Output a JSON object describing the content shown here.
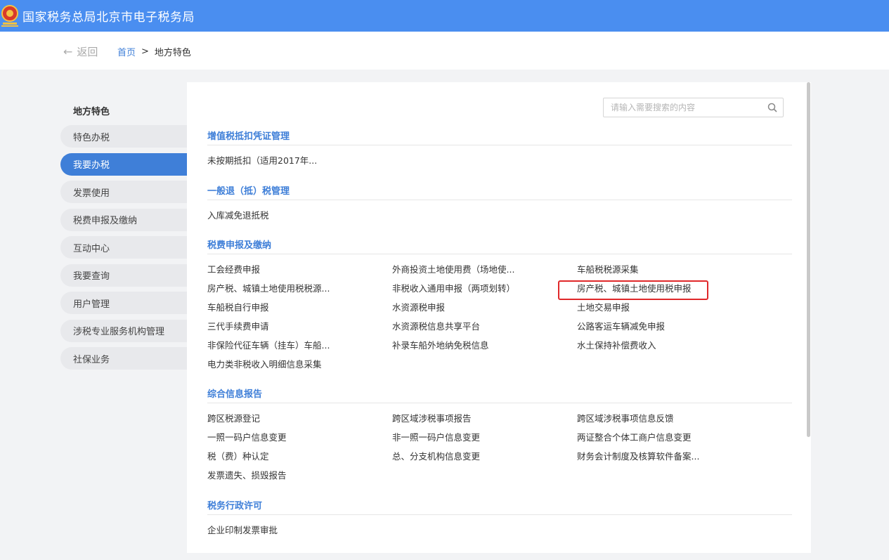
{
  "header": {
    "title": "国家税务总局北京市电子税务局"
  },
  "nav": {
    "back": "返回",
    "home": "首页",
    "sep": ">",
    "current": "地方特色"
  },
  "sidebar": {
    "title": "地方特色",
    "items": [
      {
        "label": "特色办税"
      },
      {
        "label": "我要办税"
      },
      {
        "label": "发票使用"
      },
      {
        "label": "税费申报及缴纳"
      },
      {
        "label": "互动中心"
      },
      {
        "label": "我要查询"
      },
      {
        "label": "用户管理"
      },
      {
        "label": "涉税专业服务机构管理"
      },
      {
        "label": "社保业务"
      }
    ],
    "active_index": 1
  },
  "search": {
    "placeholder": "请输入需要搜索的内容"
  },
  "sections": [
    {
      "title": "增值税抵扣凭证管理",
      "links": [
        "未按期抵扣（适用2017年..."
      ]
    },
    {
      "title": "一般退（抵）税管理",
      "links": [
        "入库减免退抵税"
      ]
    },
    {
      "title": "税费申报及缴纳",
      "links": [
        "工会经费申报",
        "外商投资土地使用费（场地使...",
        "车船税税源采集",
        "房产税、城镇土地使用税税源...",
        "非税收入通用申报（两项划转）",
        "房产税、城镇土地使用税申报",
        "车船税自行申报",
        "水资源税申报",
        "土地交易申报",
        "三代手续费申请",
        "水资源税信息共享平台",
        "公路客运车辆减免申报",
        "非保险代征车辆（挂车）车船...",
        "补录车船外地纳免税信息",
        "水土保持补偿费收入",
        "电力类非税收入明细信息采集"
      ]
    },
    {
      "title": "综合信息报告",
      "links": [
        "跨区税源登记",
        "跨区域涉税事项报告",
        "跨区域涉税事项信息反馈",
        "一照一码户信息变更",
        "非一照一码户信息变更",
        "两证整合个体工商户信息变更",
        "税（费）种认定",
        "总、分支机构信息变更",
        "财务会计制度及核算软件备案...",
        "发票遗失、损毁报告"
      ]
    },
    {
      "title": "税务行政许可",
      "links": [
        "企业印制发票审批"
      ]
    }
  ],
  "colors": {
    "header_bg": "#4a8ef0",
    "accent": "#3f7fd8",
    "highlight_border": "#e0282a"
  }
}
